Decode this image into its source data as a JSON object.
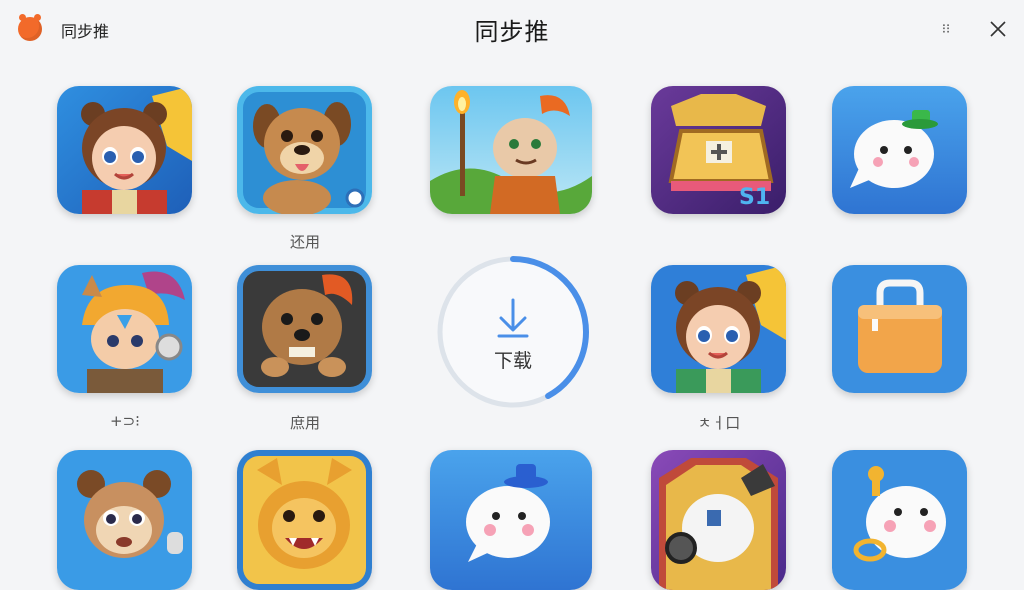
{
  "header": {
    "app_name": "同步推",
    "window_title": "同步推",
    "restore_label": "⁝⁝",
    "close_icon": "close-icon"
  },
  "apps": [
    {
      "name": "app-tile-1",
      "icon": "bear-girl-icon",
      "label": ""
    },
    {
      "name": "app-tile-2",
      "icon": "puppy-icon",
      "label": "还用"
    },
    {
      "name": "app-tile-3",
      "icon": "torch-lion-icon",
      "label": ""
    },
    {
      "name": "app-tile-4",
      "icon": "treasure-chest-icon",
      "label": ""
    },
    {
      "name": "app-tile-5",
      "icon": "white-ghost-green-hat-icon",
      "label": ""
    },
    {
      "name": "app-tile-6",
      "icon": "helmet-boy-icon",
      "label": "+⊃⁝"
    },
    {
      "name": "app-tile-7",
      "icon": "fluffy-dog-icon",
      "label": "庶用"
    },
    {
      "name": "app-tile-8",
      "icon": "bear-girl-icon",
      "label": "ㅊㅓ口"
    },
    {
      "name": "app-tile-9",
      "icon": "orange-bag-icon",
      "label": ""
    },
    {
      "name": "app-tile-10",
      "icon": "bear-kid-icon",
      "label": ""
    },
    {
      "name": "app-tile-11",
      "icon": "lion-icon",
      "label": ""
    },
    {
      "name": "app-tile-12",
      "icon": "white-ghost-blue-hat-icon",
      "label": ""
    },
    {
      "name": "app-tile-13",
      "icon": "robot-ghost-icon",
      "label": ""
    },
    {
      "name": "app-tile-14",
      "icon": "white-ghost-ring-icon",
      "label": ""
    }
  ],
  "download": {
    "label": "下载",
    "progress": 0.42,
    "icon": "download-arrow-icon"
  },
  "colors": {
    "background": "#f4f5f7",
    "accent": "#4a8fe8",
    "logo": "#f26a2a",
    "tile_blue": "#3a8fe0"
  }
}
